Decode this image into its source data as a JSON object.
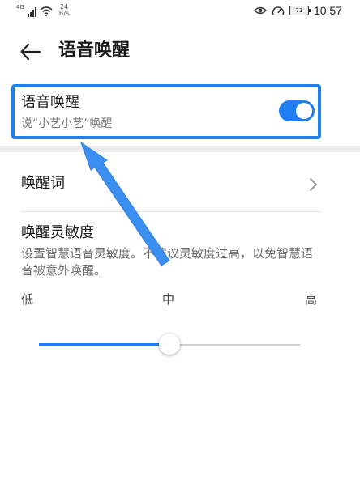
{
  "status_bar": {
    "network_type": "4G",
    "speed_value": "24",
    "speed_unit": "B/s",
    "battery": "71",
    "time": "10:57",
    "icons": [
      "signal-icon",
      "wifi-icon",
      "eye-icon",
      "speedometer-icon",
      "battery-icon"
    ]
  },
  "header": {
    "title": "语音唤醒"
  },
  "voice_wake": {
    "title": "语音唤醒",
    "subtitle": "说“小艺小艺”唤醒",
    "enabled": true
  },
  "wake_word": {
    "label": "唤醒词"
  },
  "sensitivity": {
    "title": "唤醒灵敏度",
    "description": "设置智慧语音灵敏度。不建议灵敏度过高，以免智慧语音被意外唤醒。",
    "levels": [
      "低",
      "中",
      "高"
    ],
    "value_fraction": 0.5
  },
  "colors": {
    "accent": "#1f7ef0",
    "annotation": "#3a8ff0"
  }
}
